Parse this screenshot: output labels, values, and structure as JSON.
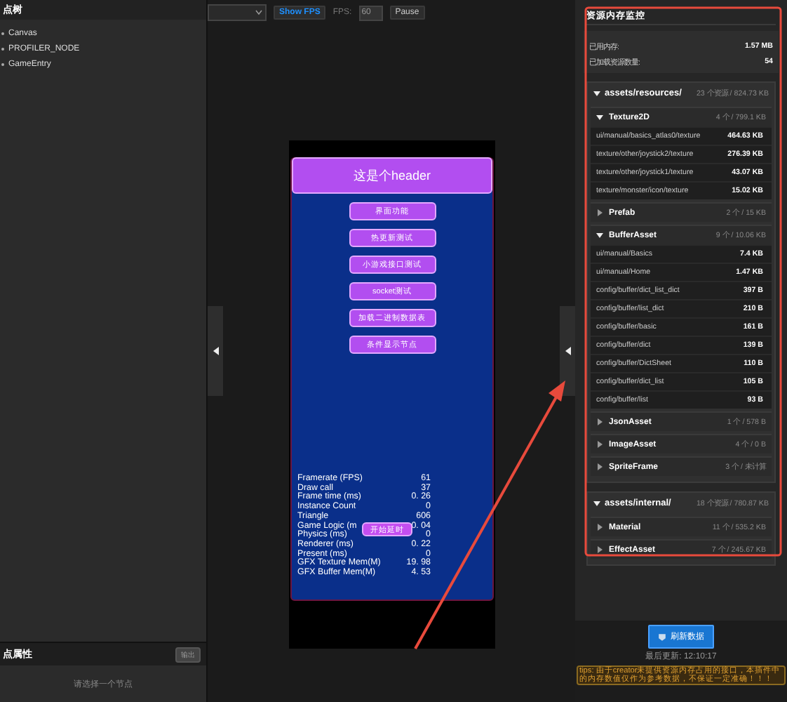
{
  "hierarchy": {
    "title": "点树",
    "nodes": [
      {
        "label": "Canvas"
      },
      {
        "label": "PROFILER_NODE"
      },
      {
        "label": "GameEntry"
      }
    ]
  },
  "inspector": {
    "title": "点属性",
    "button": "输出",
    "placeholder": "请选择一个节点"
  },
  "toolbar": {
    "show_fps": "Show FPS",
    "fps_label": "FPS:",
    "fps_value": "60",
    "pause": "Pause"
  },
  "game": {
    "header": "这是个header",
    "buttons": [
      "界面功能",
      "热更新测试",
      "小游戏接口测试",
      "socket测试",
      "加载二进制数据表",
      "条件显示节点"
    ],
    "stats": [
      {
        "label": "Framerate (FPS)",
        "value": "61"
      },
      {
        "label": "Draw call",
        "value": "37"
      },
      {
        "label": "Frame time (ms)",
        "value": "0. 26"
      },
      {
        "label": "Instance Count",
        "value": "0"
      },
      {
        "label": "Triangle",
        "value": "606"
      },
      {
        "label": "Game Logic (m",
        "value": "0. 04"
      },
      {
        "label": "Physics (ms)",
        "value": "0"
      },
      {
        "label": "Renderer (ms)",
        "value": "0. 22"
      },
      {
        "label": "Present (ms)",
        "value": "0"
      },
      {
        "label": "GFX Texture Mem(M)",
        "value": "19. 98"
      },
      {
        "label": "GFX Buffer Mem(M)",
        "value": "4. 53"
      }
    ],
    "overlay_button": "开始延时"
  },
  "monitor": {
    "title": "资源内存监控",
    "summary": [
      {
        "label": "已用内存:",
        "value": "1.57 MB"
      },
      {
        "label": "已加载资源数量:",
        "value": "54"
      }
    ],
    "groups": [
      {
        "path": "assets/resources/",
        "info": "23 个资源 / 824.73 KB",
        "expanded": true,
        "types": [
          {
            "name": "Texture2D",
            "info": "4 个 / 799.1 KB",
            "expanded": true,
            "items": [
              {
                "path": "ui/manual/basics_atlas0/texture",
                "size": "464.63 KB"
              },
              {
                "path": "texture/other/joystick2/texture",
                "size": "276.39 KB"
              },
              {
                "path": "texture/other/joystick1/texture",
                "size": "43.07 KB"
              },
              {
                "path": "texture/monster/icon/texture",
                "size": "15.02 KB"
              }
            ]
          },
          {
            "name": "Prefab",
            "info": "2 个 / 15 KB",
            "expanded": false
          },
          {
            "name": "BufferAsset",
            "info": "9 个 / 10.06 KB",
            "expanded": true,
            "items": [
              {
                "path": "ui/manual/Basics",
                "size": "7.4 KB"
              },
              {
                "path": "ui/manual/Home",
                "size": "1.47 KB"
              },
              {
                "path": "config/buffer/dict_list_dict",
                "size": "397 B"
              },
              {
                "path": "config/buffer/list_dict",
                "size": "210 B"
              },
              {
                "path": "config/buffer/basic",
                "size": "161 B"
              },
              {
                "path": "config/buffer/dict",
                "size": "139 B"
              },
              {
                "path": "config/buffer/DictSheet",
                "size": "110 B"
              },
              {
                "path": "config/buffer/dict_list",
                "size": "105 B"
              },
              {
                "path": "config/buffer/list",
                "size": "93 B"
              }
            ]
          },
          {
            "name": "JsonAsset",
            "info": "1 个 / 578 B",
            "expanded": false
          },
          {
            "name": "ImageAsset",
            "info": "4 个 / 0 B",
            "expanded": false
          },
          {
            "name": "SpriteFrame",
            "info": "3 个 / 未计算",
            "expanded": false
          }
        ]
      },
      {
        "path": "assets/internal/",
        "info": "18 个资源 / 780.87 KB",
        "expanded": true,
        "types": [
          {
            "name": "Material",
            "info": "11 个 / 535.2 KB",
            "expanded": false
          },
          {
            "name": "EffectAsset",
            "info": "7 个 / 245.67 KB",
            "expanded": false
          }
        ]
      }
    ],
    "refresh": "刷新数据",
    "last_update": "最后更新: 12:10:17",
    "tips": "tips: 由于creator未提供资源内存占用的接口，本插件中的内存数值仅作为参考数据，不保证一定准确！！！"
  }
}
